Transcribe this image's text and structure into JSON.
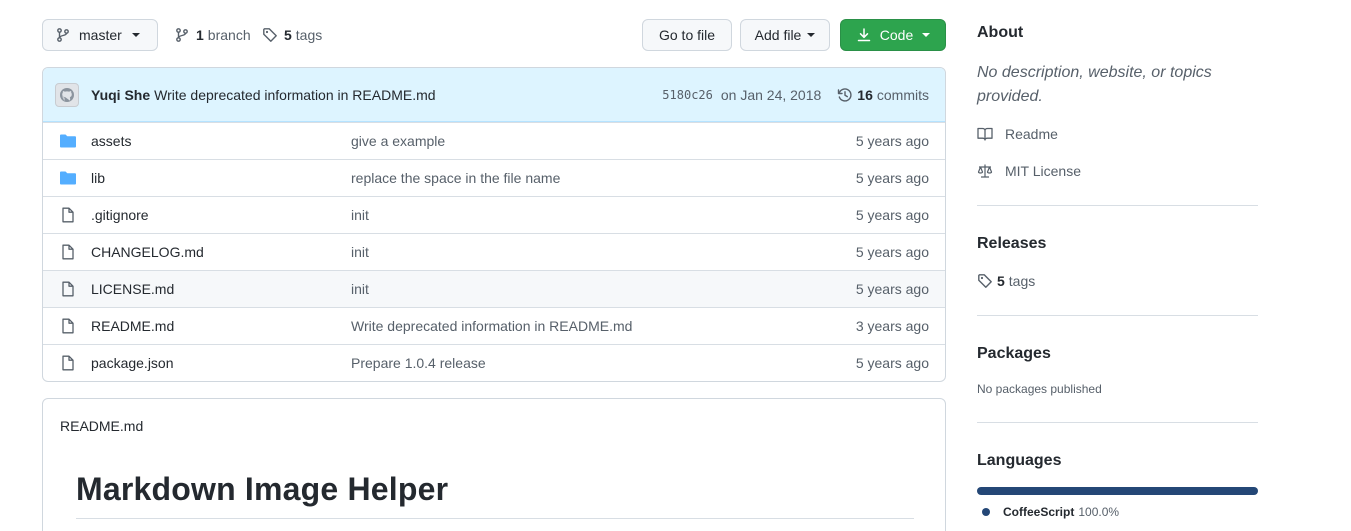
{
  "toolbar": {
    "branch_label": "master",
    "branch_count": "1",
    "branch_word": "branch",
    "tag_count": "5",
    "tag_word": "tags",
    "go_to_file": "Go to file",
    "add_file": "Add file",
    "code": "Code"
  },
  "commit": {
    "author": "Yuqi She",
    "message": "Write deprecated information in README.md",
    "sha": "5180c26",
    "date": "on Jan 24, 2018",
    "commit_count": "16",
    "commit_word": "commits"
  },
  "files": [
    {
      "type": "dir",
      "name": "assets",
      "message": "give a example",
      "age": "5 years ago"
    },
    {
      "type": "dir",
      "name": "lib",
      "message": "replace the space in the file name",
      "age": "5 years ago"
    },
    {
      "type": "file",
      "name": ".gitignore",
      "message": "init",
      "age": "5 years ago"
    },
    {
      "type": "file",
      "name": "CHANGELOG.md",
      "message": "init",
      "age": "5 years ago"
    },
    {
      "type": "file",
      "name": "LICENSE.md",
      "message": "init",
      "age": "5 years ago"
    },
    {
      "type": "file",
      "name": "README.md",
      "message": "Write deprecated information in README.md",
      "age": "3 years ago"
    },
    {
      "type": "file",
      "name": "package.json",
      "message": "Prepare 1.0.4 release",
      "age": "5 years ago"
    }
  ],
  "readme": {
    "filename": "README.md",
    "heading": "Markdown Image Helper"
  },
  "sidebar": {
    "about_title": "About",
    "about_desc": "No description, website, or topics provided.",
    "readme_link": "Readme",
    "license_link": "MIT License",
    "releases_title": "Releases",
    "releases_tag_count": "5",
    "releases_tag_word": "tags",
    "packages_title": "Packages",
    "packages_empty": "No packages published",
    "languages_title": "Languages",
    "languages": [
      {
        "name": "CoffeeScript",
        "percent": "100.0%",
        "fraction": 1.0,
        "color": "#244776"
      }
    ]
  },
  "colors": {
    "code_button": "#2da44e",
    "folder_icon": "#54aeff",
    "commit_bar": "#ddf4ff",
    "coffeescript": "#244776"
  }
}
